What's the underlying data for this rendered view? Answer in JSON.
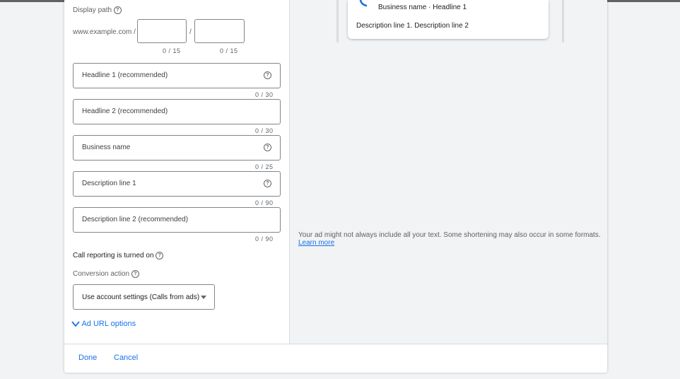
{
  "form": {
    "display_path": {
      "label": "Display path",
      "prefix": "www.example.com /",
      "separator": "/",
      "path1_value": "",
      "path2_value": "",
      "path1_counter": "0 / 15",
      "path2_counter": "0 / 15"
    },
    "fields": [
      {
        "placeholder": "Headline 1 (recommended)",
        "counter": "0 / 30",
        "has_help": true
      },
      {
        "placeholder": "Headline 2 (recommended)",
        "counter": "0 / 30",
        "has_help": false
      },
      {
        "placeholder": "Business name",
        "counter": "0 / 25",
        "has_help": true
      },
      {
        "placeholder": "Description line 1",
        "counter": "0 / 90",
        "has_help": true
      },
      {
        "placeholder": "Description line 2 (recommended)",
        "counter": "0 / 90",
        "has_help": false
      }
    ],
    "call_reporting": "Call reporting is turned on",
    "conversion_action": {
      "label": "Conversion action",
      "selected": "Use account settings (Calls from ads)"
    },
    "ad_url_options": "Ad URL options"
  },
  "preview": {
    "headline": "Business name · Headline 1",
    "description": "Description line 1. Description line 2",
    "notice": "Your ad might not always include all your text. Some shortening may also occur in some formats.",
    "learn_more": "Learn more"
  },
  "footer": {
    "done_label": "Done",
    "cancel_label": "Cancel"
  },
  "icons": {
    "help": "help-circle-icon",
    "phone": "phone-icon",
    "chevron": "chevron-down-icon",
    "caret": "dropdown-caret-icon"
  },
  "colors": {
    "accent": "#1a73e8",
    "border": "#80868b",
    "background": "#f1f3f4"
  }
}
